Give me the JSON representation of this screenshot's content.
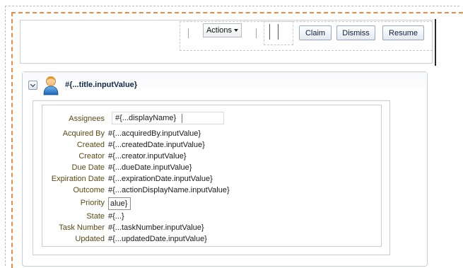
{
  "toolbar": {
    "actions_label": "Actions",
    "claim_label": "Claim",
    "dismiss_label": "Dismiss",
    "resume_label": "Resume"
  },
  "task": {
    "title": "#{...title.inputValue}"
  },
  "fields": {
    "assignees_label": "Assignees",
    "assignees_value": "#{...displayName}",
    "acquired_by_label": "Acquired By",
    "acquired_by_value": "#{...acquiredBy.inputValue}",
    "created_label": "Created",
    "created_value": "#{...createdDate.inputValue}",
    "creator_label": "Creator",
    "creator_value": "#{...creator.inputValue}",
    "due_date_label": "Due Date",
    "due_date_value": "#{...dueDate.inputValue}",
    "expiration_date_label": "Expiration Date",
    "expiration_date_value": "#{...expirationDate.inputValue}",
    "outcome_label": "Outcome",
    "outcome_value": "#{...actionDisplayName.inputValue}",
    "priority_label": "Priority",
    "priority_value": "alue}",
    "state_label": "State",
    "state_value": "#{...}",
    "task_number_label": "Task Number",
    "task_number_value": "#{...taskNumber.inputValue}",
    "updated_label": "Updated",
    "updated_value": "#{...updatedDate.inputValue}"
  },
  "icons": {
    "dropdown": "chevron-down-icon",
    "disclosure": "disclosure-icon",
    "user": "user-icon"
  },
  "colors": {
    "accent_dash": "#f08a3c",
    "label_text": "#5a4a12",
    "title_text": "#0f2a4a"
  }
}
